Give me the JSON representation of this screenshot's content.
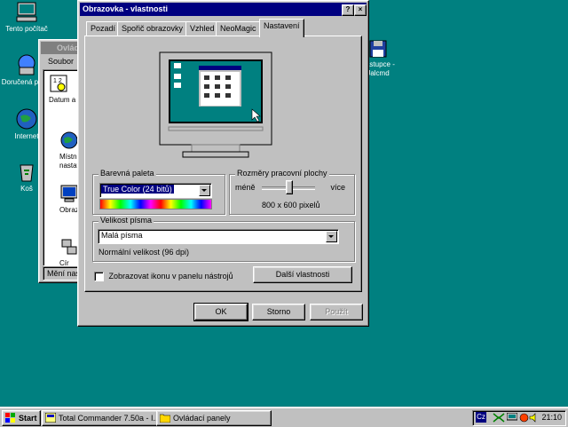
{
  "desktop": {
    "icons": [
      {
        "label": "Tento počítač"
      },
      {
        "label": "Doručená pošta"
      },
      {
        "label": "Internet"
      },
      {
        "label": "Koš"
      }
    ],
    "right_icon_label": "Zástupce - Jalcmd"
  },
  "bg_window": {
    "title": "Ovlád",
    "menu": "Soubor",
    "items": [
      "Datum a",
      "Místní nastave",
      "Obrazov",
      "Cír"
    ],
    "status": "Mění nast"
  },
  "dialog": {
    "title": "Obrazovka - vlastnosti",
    "help_btn": "?",
    "close_btn": "×",
    "tabs": [
      "Pozadí",
      "Spořič obrazovky",
      "Vzhled",
      "NeoMagic",
      "Nastavení"
    ],
    "active_tab": "Nastavení",
    "palette": {
      "label": "Barevná paleta",
      "value": "True Color (24 bitů)"
    },
    "resolution": {
      "label": "Rozměry pracovní plochy",
      "less": "méně",
      "more": "více",
      "value": "800 x 600 pixelů",
      "slider_position": 0.5
    },
    "font_size": {
      "label": "Velikost písma",
      "value": "Malá písma",
      "note": "Normální velikost (96 dpi)"
    },
    "show_icon_checkbox": {
      "label": "Zobrazovat ikonu v panelu nástrojů",
      "checked": false
    },
    "advanced_button": "Další vlastnosti",
    "ok": "OK",
    "cancel": "Storno",
    "apply": "Použít"
  },
  "taskbar": {
    "start": "Start",
    "tasks": [
      "Total Commander 7.50a - I...",
      "Ovládací panely"
    ],
    "tray_lang": "Cz",
    "clock": "21:10"
  },
  "colors": {
    "desktop": "#008080",
    "titlebar": "#000080",
    "face": "#c0c0c0"
  }
}
